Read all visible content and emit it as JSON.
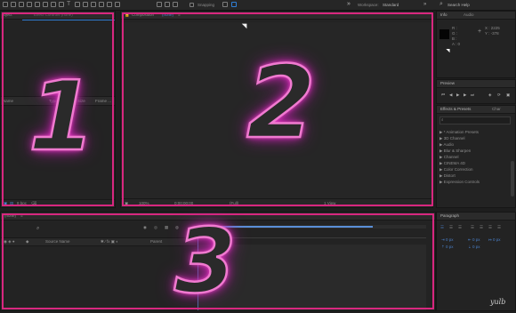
{
  "toolbar": {
    "snapping_label": "Snapping",
    "workspace_label": "Workspace:",
    "workspace_value": "Standard",
    "search_placeholder": "Search Help"
  },
  "project_panel": {
    "tab_label": "oject",
    "effect_controls_label": "Effect Controls (none)",
    "columns": [
      "Name",
      "Type",
      "Size",
      "Frame ..."
    ],
    "footer_label": "8 bpc",
    "overlay_number": "1"
  },
  "composition_panel": {
    "tab_label": "Composition",
    "comp_name": "(none)",
    "footer_zoom": "100%",
    "footer_time": "0;00;00;00",
    "footer_quality": "(Full)",
    "footer_view": "1 View",
    "overlay_number": "2"
  },
  "info_panel": {
    "tab_label": "Info",
    "audio_tab_label": "Audio",
    "r_label": "R :",
    "g_label": "G :",
    "b_label": "B :",
    "a_label": "A : 0",
    "x_label": "X : 2225",
    "y_label": "Y : -378"
  },
  "preview_panel": {
    "tab_label": "Preview"
  },
  "effects_panel": {
    "tab_label": "Effects & Presets",
    "char_tab_label": "Char",
    "items": [
      "* Animation Presets",
      "3D Channel",
      "Audio",
      "Blur & Sharpen",
      "Channel",
      "CINEMA 4D",
      "Color Correction",
      "Distort",
      "Expression Controls"
    ]
  },
  "timeline_panel": {
    "tab_label": "(none)",
    "source_name_label": "Source Name",
    "parent_label": "Parent",
    "overlay_number": "3"
  },
  "paragraph_panel": {
    "tab_label": "Paragraph",
    "px_values": [
      "0 px",
      "0 px",
      "0 px",
      "0 px",
      "0 px"
    ]
  },
  "watermark": "yulb"
}
